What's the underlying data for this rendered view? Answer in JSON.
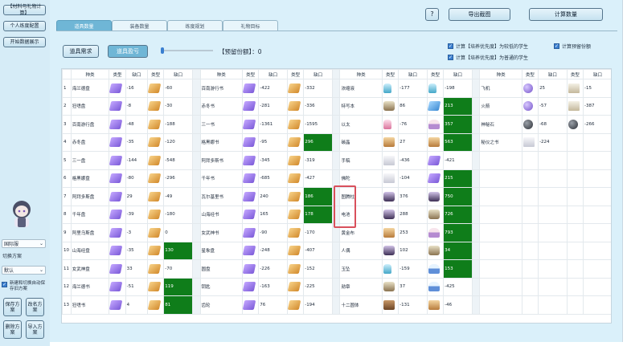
{
  "left_panel": {
    "buttons": [
      "【材料与礼物计算】",
      "个人练度配置",
      "开始数据展示"
    ],
    "server_select": "国际服",
    "switch_plan_label": "切换方案",
    "plan_select": "默认",
    "auto_save_label": "新建和切换自动保存旧方案",
    "grid_buttons": [
      "保存方案",
      "改名方案",
      "删除方案",
      "导入方案"
    ]
  },
  "main": {
    "help_label": "?",
    "export_label": "导出截图",
    "calc_label": "计算数量",
    "tabs": [
      "道具数量",
      "装备数量",
      "练度规划",
      "礼物目标"
    ],
    "active_tab": 0,
    "prop_demand_label": "道具需求",
    "prop_stock_label": "道具盈亏",
    "reserve_label": "【预留份额】：",
    "reserve_value": "0",
    "checkboxes": [
      "计算【培养优先度】为较低的学生",
      "计算【培养优先度】为普通的学生",
      "计算预留份额"
    ]
  },
  "table": {
    "headers": [
      "",
      "种类",
      "类型",
      "缺口",
      "类型",
      "缺口",
      "",
      "种类",
      "类型",
      "缺口",
      "类型",
      "缺口",
      "",
      "种类",
      "类型",
      "缺口",
      "类型",
      "缺口",
      "",
      "种类",
      "类型",
      "缺口",
      "类型",
      "缺口"
    ],
    "rows": [
      {
        "n": "1",
        "g1": [
          "海兰德盘",
          "-16",
          "-60"
        ],
        "g2": [
          "百南游行书",
          "-422",
          "-332"
        ],
        "g3": [
          "浓缩液",
          "-177",
          "-198"
        ],
        "g4": [
          "飞机",
          "25",
          "-15"
        ]
      },
      {
        "n": "2",
        "g1": [
          "狂嗜盘",
          "-8",
          "-30"
        ],
        "g2": [
          "赤冬书",
          "-281",
          "-336"
        ],
        "g3": [
          "特写本",
          "86",
          "213"
        ],
        "g4": [
          "火箭",
          "-57",
          "-387"
        ]
      },
      {
        "n": "3",
        "g1": [
          "百南游行盘",
          "-48",
          "-188"
        ],
        "g2": [
          "三一书",
          "-1361",
          "-1595"
        ],
        "g3": [
          "以太",
          "-76",
          "357"
        ],
        "g4": [
          "神秘石",
          "-68",
          "-266"
        ]
      },
      {
        "n": "4",
        "g1": [
          "赤冬盘",
          "-35",
          "-120"
        ],
        "g2": [
          "格黑娜书",
          "-95",
          "296"
        ],
        "g3": [
          "碳晶",
          "27",
          "563"
        ],
        "g4": [
          "秘仪之书",
          "-224",
          ""
        ]
      },
      {
        "n": "5",
        "g1": [
          "三一盘",
          "-144",
          "-548"
        ],
        "g2": [
          "阿拜多斯书",
          "-345",
          "-319"
        ],
        "g3": [
          "手稿",
          "-436",
          "-421"
        ],
        "g4": [
          "",
          "",
          ""
        ]
      },
      {
        "n": "6",
        "g1": [
          "格黑娜盘",
          "-80",
          "-296"
        ],
        "g2": [
          "千年书",
          "-685",
          "-427"
        ],
        "g3": [
          "佛陀",
          "-104",
          "215"
        ],
        "g4": [
          "",
          "",
          ""
        ]
      },
      {
        "n": "7",
        "g1": [
          "阿拜多斯盘",
          "29",
          "-49"
        ],
        "g2": [
          "瓦尔基里书",
          "240",
          "186"
        ],
        "g3": [
          "图腾柱",
          "376",
          "750"
        ],
        "g4": [
          "",
          "",
          ""
        ]
      },
      {
        "n": "8",
        "g1": [
          "千年盘",
          "-39",
          "-180"
        ],
        "g2": [
          "山海经书",
          "165",
          "178"
        ],
        "g3": [
          "电池",
          "288",
          "726"
        ],
        "g4": [
          "",
          "",
          ""
        ]
      },
      {
        "n": "9",
        "g1": [
          "阿里乌斯盘",
          "-3",
          "0"
        ],
        "g2": [
          "女武神书",
          "-90",
          "-170"
        ],
        "g3": [
          "黄金布",
          "253",
          "793"
        ],
        "g4": [
          "",
          "",
          ""
        ]
      },
      {
        "n": "10",
        "g1": [
          "山海经盘",
          "-35",
          "130"
        ],
        "g2": [
          "星象盘",
          "-248",
          "-407"
        ],
        "g3": [
          "人偶",
          "102",
          "34"
        ],
        "g4": [
          "",
          "",
          ""
        ]
      },
      {
        "n": "11",
        "g1": [
          "女武神盘",
          "33",
          "-70"
        ],
        "g2": [
          "圆盘",
          "-226",
          "-152"
        ],
        "g3": [
          "玉坠",
          "-159",
          "153"
        ],
        "g4": [
          "",
          "",
          ""
        ]
      },
      {
        "n": "12",
        "g1": [
          "海兰德书",
          "-51",
          "119"
        ],
        "g2": [
          "钥匙",
          "-163",
          "-225"
        ],
        "g3": [
          "勋章",
          "37",
          "-425"
        ],
        "g4": [
          "",
          "",
          ""
        ]
      },
      {
        "n": "13",
        "g1": [
          "狂嗜书",
          "4",
          "81"
        ],
        "g2": [
          "齿轮",
          "76",
          "-194"
        ],
        "g3": [
          "十二圆体",
          "-131",
          "-46"
        ],
        "g4": [
          "",
          "",
          ""
        ]
      }
    ],
    "icons": {
      "g1": [
        "book-purple-icon",
        "book-gold-icon"
      ],
      "g2": [
        "book-purple-icon",
        "book-gold-icon"
      ],
      "g3": [
        "material-small-icon",
        "material-large-icon"
      ],
      "g4": [
        "material-small-icon",
        "material-large-icon"
      ]
    },
    "highlight_color": "#0f7d1a",
    "selection_color": "#d9505c"
  }
}
